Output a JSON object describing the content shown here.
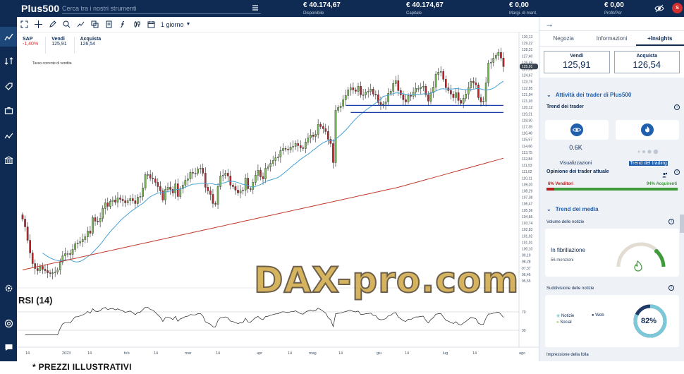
{
  "app": {
    "logo": "Plus500",
    "search_placeholder": "Cerca tra i nostri strumenti",
    "stats": [
      {
        "value": "€ 40.174,67",
        "label": "Disponibile"
      },
      {
        "value": "€ 40.174,67",
        "label": "Capitale"
      },
      {
        "value": "€ 0,00",
        "label": "Margi. di mant."
      },
      {
        "value": "€ 0,00",
        "label": "Profit/Per"
      }
    ],
    "avatar_initial": "S"
  },
  "toolbar": {
    "period": "1 giorno"
  },
  "instrument": {
    "symbol": "SAP",
    "change": "-1,40%",
    "sell_label": "Vendi",
    "sell_price": "125,91",
    "buy_label": "Acquista",
    "buy_price": "126,54",
    "note": "Tasso corrente di vendita"
  },
  "indicator": {
    "rsi_label": "RSI (14)"
  },
  "watermark": "DAX-pro.com",
  "footer_note": "* PREZZI ILLUSTRATIVI",
  "chart_data": {
    "type": "candlestick",
    "x_tick_labels": [
      "14",
      "2023",
      "14",
      "feb",
      "14",
      "mar",
      "14",
      "apr",
      "14",
      "mag",
      "14",
      "giu",
      "14",
      "lug",
      "14",
      "ago"
    ],
    "y_tick_labels": [
      "130,13",
      "129,22",
      "128,31",
      "127,40",
      "126,49",
      "125,58",
      "124,67",
      "123,76",
      "122,85",
      "121,94",
      "121,03",
      "120,12",
      "119,21",
      "118,30",
      "117,39",
      "116,48",
      "115,57",
      "114,66",
      "113,75",
      "112,84",
      "111,93",
      "111,02",
      "110,11",
      "109,20",
      "108,29",
      "107,38",
      "106,47",
      "105,56",
      "104,65",
      "103,74",
      "102,83",
      "101,92",
      "101,01",
      "100,10",
      "99,19",
      "98,28",
      "97,37",
      "96,46",
      "95,55"
    ],
    "price_marker": "125,91",
    "rsi_levels": [
      70,
      30
    ],
    "ylim": [
      95.55,
      130.13
    ],
    "closes": [
      104.3,
      103.2,
      101.3,
      99.5,
      98.0,
      97.3,
      97.0,
      97.6,
      97.2,
      97.0,
      96.7,
      96.6,
      96.7,
      96.8,
      97.1,
      98.2,
      99.1,
      99.4,
      99.4,
      99.3,
      100.0,
      100.8,
      100.9,
      101.1,
      101.4,
      101.8,
      102.6,
      102.3,
      104.5,
      104.0,
      103.9,
      104.4,
      105.8,
      106.6,
      106.1,
      106.8,
      107.0,
      106.7,
      107.3,
      107.1,
      106.9,
      106.6,
      106.9,
      107.2,
      106.9,
      106.5,
      107.4,
      107.5,
      108.7,
      110.6,
      110.6,
      110.1,
      110.0,
      109.5,
      108.9,
      108.3,
      107.0,
      108.5,
      108.8,
      108.5,
      108.0,
      109.3,
      107.5,
      108.6,
      109.1,
      109.8,
      110.0,
      110.9,
      110.8,
      110.8,
      111.4,
      111.5,
      110.8,
      108.8,
      108.3,
      107.8,
      106.5,
      106.4,
      108.9,
      110.4,
      110.5,
      110.8,
      110.4,
      109.1,
      108.9,
      108.4,
      108.0,
      108.3,
      108.4,
      110.1,
      108.6,
      108.5,
      109.5,
      110.5,
      111.2,
      110.3,
      110.0,
      111.5,
      111.7,
      112.2,
      112.6,
      113.0,
      113.1,
      114.0,
      114.3,
      114.2,
      114.1,
      114.5,
      114.6,
      115.0,
      114.7,
      114.4,
      114.3,
      115.2,
      115.8,
      116.2,
      116.0,
      116.3,
      117.7,
      117.4,
      117.1,
      116.7,
      115.6,
      115.0,
      112.3,
      119.7,
      120.1,
      120.3,
      121.2,
      121.8,
      122.6,
      122.9,
      122.6,
      122.4,
      123.1,
      121.9,
      121.9,
      122.3,
      122.4,
      122.7,
      122.0,
      121.9,
      120.8,
      120.5,
      120.6,
      120.9,
      122.1,
      122.4,
      123.5,
      123.9,
      122.5,
      121.9,
      121.2,
      120.9,
      121.8,
      121.7,
      122.3,
      122.8,
      122.8,
      123.0,
      123.1,
      121.9,
      121.0,
      122.2,
      123.0,
      124.8,
      125.1,
      125.2,
      124.1,
      122.9,
      122.5,
      122.0,
      121.5,
      122.2,
      121.1,
      120.7,
      121.4,
      122.0,
      122.9,
      123.8,
      123.6,
      123.3,
      121.5,
      120.9,
      121.0,
      123.6,
      126.4,
      126.5,
      127.1,
      127.5,
      127.9,
      127.1,
      125.9
    ]
  },
  "right_panel": {
    "tabs": [
      "Negozia",
      "Informazioni",
      "+Insights"
    ],
    "sell_label": "Vendi",
    "sell_price": "125,91",
    "buy_label": "Acquista",
    "buy_price": "126,54",
    "traders_section": "Attività dei trader di Plus500",
    "traders_trend_title": "Trend dei trader",
    "views_value": "0.6K",
    "views_caption": "Visualizzazioni",
    "trending_caption": "Trend del trading",
    "opinion_title": "Opinione dei trader attuale",
    "sellers_label": "6% Venditori",
    "buyers_label": "94% Acquirenti",
    "sellers_fraction": 0.06,
    "media_section": "Trend dei media",
    "news_volume_title": "Volume delle notizie",
    "news_state": "In fibrillazione",
    "news_mentions": "56 menzioni",
    "news_split_title": "Suddivisione delle notizie",
    "legend_news": "Notizie",
    "legend_web": "Web",
    "legend_social": "Social",
    "news_percent": "82%",
    "news_fraction": 0.82,
    "crowd_title": "Impressione della folla"
  },
  "colors": {
    "navy": "#0f2b53",
    "candle_up": "#7fbf5a",
    "candle_down": "#c0272d",
    "ma_short": "#4aa3d6",
    "ma_long": "#c0392b",
    "support": "#1b3fa8"
  }
}
